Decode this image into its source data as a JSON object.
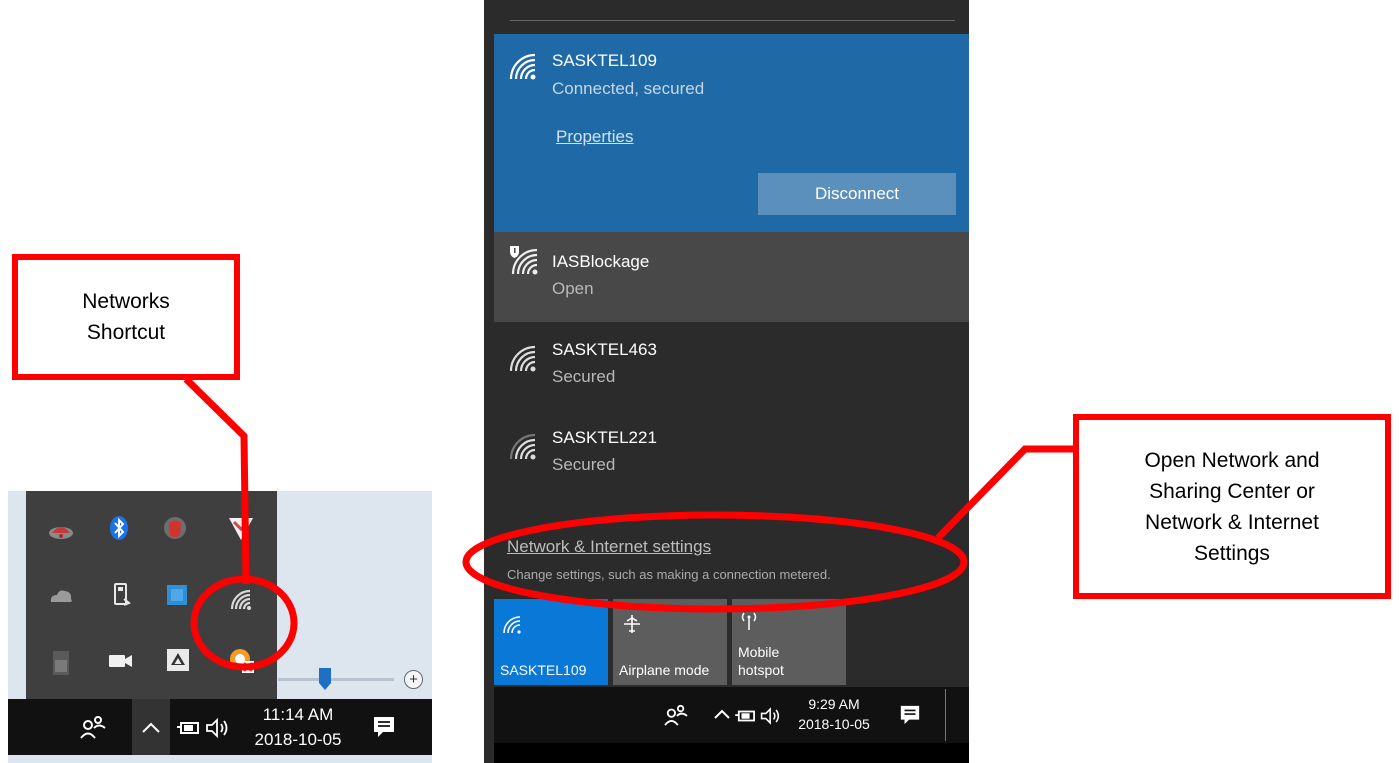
{
  "left_panel": {
    "overflow_icons": [
      {
        "name": "car-icon"
      },
      {
        "name": "bluetooth-icon"
      },
      {
        "name": "shield-icon"
      },
      {
        "name": "pocket-icon"
      },
      {
        "name": "onedrive-icon"
      },
      {
        "name": "usb-icon"
      },
      {
        "name": "app-square-icon"
      },
      {
        "name": "wifi-icon"
      },
      {
        "name": "disk-icon"
      },
      {
        "name": "video-camera-icon"
      },
      {
        "name": "google-drive-icon"
      },
      {
        "name": "error-badge-icon"
      }
    ],
    "taskbar": {
      "time": "11:14 AM",
      "date": "2018-10-05"
    }
  },
  "flyout": {
    "connected": {
      "ssid": "SASKTEL109",
      "status": "Connected, secured",
      "properties_label": "Properties",
      "disconnect_label": "Disconnect"
    },
    "networks": [
      {
        "ssid": "IASBlockage",
        "status": "Open"
      },
      {
        "ssid": "SASKTEL463",
        "status": "Secured"
      },
      {
        "ssid": "SASKTEL221",
        "status": "Secured"
      }
    ],
    "settings_link": "Network & Internet settings",
    "settings_sub": "Change settings, such as making a connection metered.",
    "quick_actions": [
      {
        "label": "SASKTEL109",
        "active": true
      },
      {
        "label": "Airplane mode",
        "active": false
      },
      {
        "label_line1": "Mobile",
        "label_line2": "hotspot",
        "active": false
      }
    ],
    "taskbar": {
      "time": "9:29 AM",
      "date": "2018-10-05"
    }
  },
  "annotations": {
    "networks_shortcut": "Networks\nShortcut",
    "open_network": "Open Network and\nSharing Center or\nNetwork & Internet\nSettings"
  },
  "colors": {
    "accent": "#1f6aa6",
    "quick_action_active": "#0a78d7",
    "annotation": "#ff0000"
  }
}
